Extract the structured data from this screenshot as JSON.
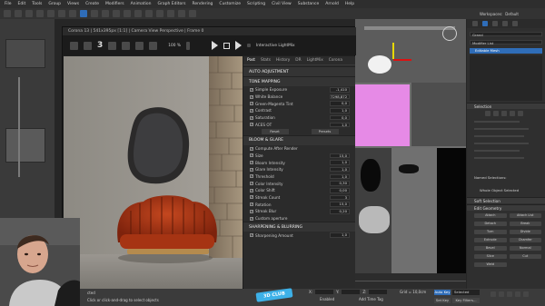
{
  "menubar": [
    "File",
    "Edit",
    "Tools",
    "Group",
    "Views",
    "Create",
    "Modifiers",
    "Animation",
    "Graph Editors",
    "Rendering",
    "Customize",
    "Scripting",
    "Civil View",
    "Substance",
    "Arnold",
    "Help"
  ],
  "top_right": {
    "workspace_label": "Workspaces:",
    "workspace_value": "Default",
    "grand_label": "Grand"
  },
  "vfb": {
    "title": "Corona 13 | 541x395px [1:1] | Camera View Perspective | Frame 0",
    "zoom": "100 %",
    "interactive_label": "Interactive LightMix",
    "tabs": [
      "Post",
      "Stats",
      "History",
      "DR",
      "LightMix",
      "Corona"
    ],
    "active_tab": "Post",
    "sections": [
      {
        "title": "AUTO ADJUSTMENT",
        "rows": []
      },
      {
        "title": "TONE MAPPING",
        "rows": [
          {
            "label": "Simple Exposure",
            "value": "-1,410"
          },
          {
            "label": "White Balance",
            "value": "7298,872"
          },
          {
            "label": "Green-Magenta Tint",
            "value": "0,0"
          },
          {
            "label": "Contrast",
            "value": "1,0"
          },
          {
            "label": "Saturation",
            "value": "0,0"
          },
          {
            "label": "ACES OT",
            "value": "1,0"
          }
        ],
        "buttons": [
          "Reset",
          "Presets"
        ]
      },
      {
        "title": "BLOOM & GLARE",
        "rows": [
          {
            "label": "Compute After Render",
            "value": ""
          },
          {
            "label": "Size",
            "value": "15,0"
          },
          {
            "label": "Bloom Intensity",
            "value": "1,0"
          },
          {
            "label": "Glare Intensity",
            "value": "1,0"
          },
          {
            "label": "Threshold",
            "value": "1,0"
          },
          {
            "label": "Color Intensity",
            "value": "0,30"
          },
          {
            "label": "Color Shift",
            "value": "0,00"
          },
          {
            "label": "Streak Count",
            "value": "3"
          },
          {
            "label": "Rotation",
            "value": "15,0"
          },
          {
            "label": "Streak Blur",
            "value": "0,20"
          },
          {
            "label": "Custom aperture",
            "value": ""
          }
        ]
      },
      {
        "title": "SHARPENING & BLURRING",
        "rows": [
          {
            "label": "Sharpening Amount",
            "value": "1,0"
          }
        ]
      }
    ]
  },
  "command_panel": {
    "modifier_list": "Modifier List",
    "editable_mesh": "Editable Mesh",
    "selection": "Selection",
    "soft_selection": "Soft Selection",
    "edit_geometry": "Edit Geometry",
    "whole_object": "Whole Object Selected",
    "named_selections": "Named Selections:",
    "buttons": [
      "Attach",
      "Attach List",
      "Detach",
      "Break",
      "Turn",
      "Divide",
      "Extrude",
      "Chamfer",
      "Bevel",
      "Normal",
      "Slice",
      "Cut",
      "Weld"
    ]
  },
  "status": {
    "prompt": "Click or click-and-drag to select objects",
    "selected": "cted",
    "autokey": "Auto Key",
    "selected_label": "Selected",
    "set_key": "Set Key",
    "key_filters": "Key Filters...",
    "enabled": "Enabled",
    "add_time_tag": "Add Time Tag",
    "grid": "Grid = 10,0cm",
    "x": "X:",
    "y": "Y:",
    "z": "Z:"
  },
  "watermark": "3D CLUB",
  "colors": {
    "accent": "#2f6db8",
    "ui_bg": "#2b2b2b",
    "check": "#e0e0e0"
  }
}
